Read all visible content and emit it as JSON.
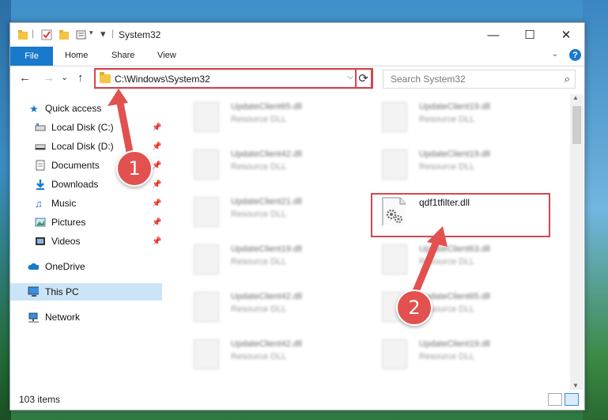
{
  "window": {
    "title": "System32",
    "minimize_glyph": "—",
    "maximize_glyph": "☐",
    "close_glyph": "✕"
  },
  "ribbon": {
    "file": "File",
    "home": "Home",
    "share": "Share",
    "view": "View",
    "help_glyph": "?"
  },
  "nav": {
    "back_glyph": "←",
    "forward_glyph": "→",
    "recent_glyph": "⌄",
    "up_glyph": "↑",
    "address": "C:\\Windows\\System32",
    "address_dropdown_glyph": "⌵",
    "refresh_glyph": "⟳"
  },
  "search": {
    "placeholder": "Search System32",
    "icon_glyph": "⌕"
  },
  "sidebar": {
    "items": [
      {
        "label": "Quick access",
        "pinned": false
      },
      {
        "label": "Local Disk (C:)",
        "pinned": true
      },
      {
        "label": "Local Disk (D:)",
        "pinned": true
      },
      {
        "label": "Documents",
        "pinned": true
      },
      {
        "label": "Downloads",
        "pinned": true
      },
      {
        "label": "Music",
        "pinned": true
      },
      {
        "label": "Pictures",
        "pinned": true
      },
      {
        "label": "Videos",
        "pinned": true
      },
      {
        "label": "OneDrive",
        "pinned": false
      },
      {
        "label": "This PC",
        "pinned": false,
        "selected": true
      },
      {
        "label": "Network",
        "pinned": false
      }
    ]
  },
  "files": [
    {
      "name": "UpdateClient65.dll",
      "type": "Resource DLL"
    },
    {
      "name": "UpdateClient19.dll",
      "type": "Resource DLL"
    },
    {
      "name": "UpdateClient42.dll",
      "type": "Resource DLL"
    },
    {
      "name": "UpdateClient19.dll",
      "type": "Resource DLL"
    },
    {
      "name": "UpdateClient21.dll",
      "type": "Resource DLL"
    },
    {
      "name": "qdf1tfilter.dll",
      "type": ""
    },
    {
      "name": "UpdateClient19.dll",
      "type": "Resource DLL"
    },
    {
      "name": "UpdateClient63.dll",
      "type": "Resource DLL"
    },
    {
      "name": "UpdateClient42.dll",
      "type": "Resource DLL"
    },
    {
      "name": "UpdateClient65.dll",
      "type": "Resource DLL"
    },
    {
      "name": "UpdateClient42.dll",
      "type": "Resource DLL"
    },
    {
      "name": "UpdateClient19.dll",
      "type": "Resource DLL"
    }
  ],
  "status": {
    "item_count": "103 items"
  },
  "callouts": {
    "step1": "1",
    "step2": "2"
  },
  "colors": {
    "accent": "#1979ca",
    "highlight": "#d7454e",
    "selected_bg": "#cce4f7"
  }
}
